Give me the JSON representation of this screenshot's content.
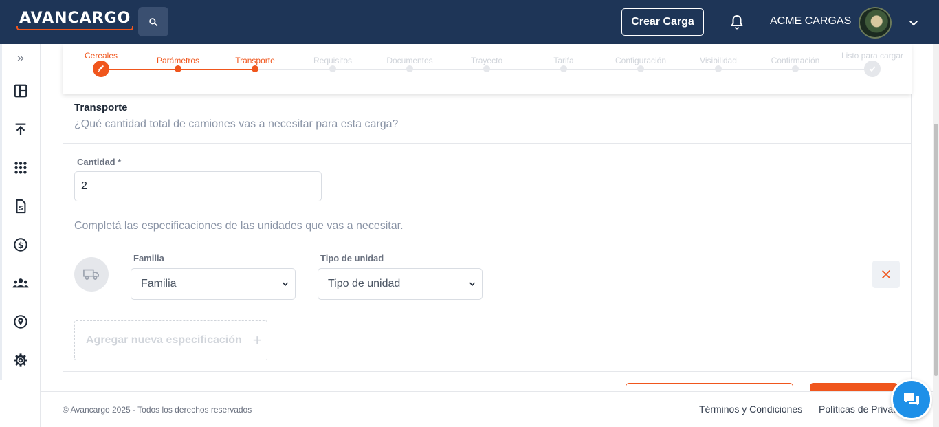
{
  "header": {
    "logo_text": "AVANCARGO",
    "search_icon": "search-icon",
    "create_button_label": "Crear Carga",
    "notification_icon": "bell-icon",
    "company_name": "ACME CARGAS",
    "user_menu_icon": "chevron-down-icon"
  },
  "sidebar": {
    "items": [
      {
        "name": "expand-icon"
      },
      {
        "name": "dashboard-icon"
      },
      {
        "name": "upload-icon"
      },
      {
        "name": "apps-grid-icon"
      },
      {
        "name": "invoice-icon"
      },
      {
        "name": "dollar-icon"
      },
      {
        "name": "groups-icon"
      },
      {
        "name": "location-icon"
      },
      {
        "name": "gear-icon"
      }
    ]
  },
  "stepper": {
    "steps": [
      {
        "label": "Cereales",
        "state": "current-icon"
      },
      {
        "label": "Parámetros",
        "state": "done"
      },
      {
        "label": "Transporte",
        "state": "done"
      },
      {
        "label": "Requisitos",
        "state": "pending"
      },
      {
        "label": "Documentos",
        "state": "pending"
      },
      {
        "label": "Trayecto",
        "state": "pending"
      },
      {
        "label": "Tarifa",
        "state": "pending"
      },
      {
        "label": "Configuración",
        "state": "pending"
      },
      {
        "label": "Visibilidad",
        "state": "pending"
      },
      {
        "label": "Confirmación",
        "state": "pending"
      },
      {
        "label": "Listo para cargar",
        "state": "final"
      }
    ]
  },
  "transport": {
    "title": "Transporte",
    "subtitle": "¿Qué cantidad total de camiones vas a necesitar para esta carga?",
    "quantity_label": "Cantidad *",
    "quantity_value": "2",
    "specs_text": "Completá las especificaciones de las unidades que vas a necesitar.",
    "family_label": "Familia",
    "family_selected": "Familia",
    "unit_type_label": "Tipo de unidad",
    "unit_type_selected": "Tipo de unidad",
    "add_spec_label": "Agregar nueva especificación",
    "add_spec_plus": "+"
  },
  "footer": {
    "copyright": "© Avancargo 2025 - Todos los derechos reservados",
    "terms_link": "Términos y Condiciones",
    "privacy_link": "Políticas de Privacidad"
  },
  "colors": {
    "header_bg": "#1e3557",
    "accent": "#f0561d",
    "chat": "#1e90e8"
  }
}
